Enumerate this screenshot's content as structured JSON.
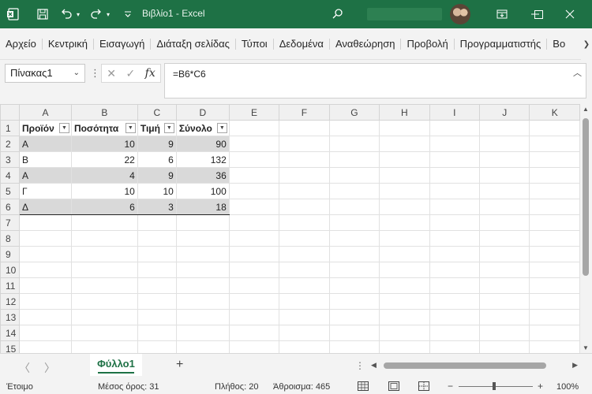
{
  "window": {
    "title": "Βιβλίο1 - Excel"
  },
  "ribbon": {
    "tabs": [
      "Αρχείο",
      "Κεντρική",
      "Εισαγωγή",
      "Διάταξη σελίδας",
      "Τύποι",
      "Δεδομένα",
      "Αναθεώρηση",
      "Προβολή",
      "Προγραμματιστής",
      "Βο"
    ]
  },
  "formula_bar": {
    "name_box": "Πίνακας1",
    "formula": "=B6*C6",
    "fx": "fx"
  },
  "sheet": {
    "columns": [
      "A",
      "B",
      "C",
      "D",
      "E",
      "F",
      "G",
      "H",
      "I",
      "J",
      "K"
    ],
    "rows": [
      "1",
      "2",
      "3",
      "4",
      "5",
      "6",
      "7",
      "8",
      "9",
      "10",
      "11",
      "12",
      "13",
      "14",
      "15"
    ],
    "table_headers": [
      "Προϊόν",
      "Ποσότητα",
      "Τιμή",
      "Σύνολο"
    ],
    "table_rows": [
      [
        "A",
        "10",
        "9",
        "90"
      ],
      [
        "B",
        "22",
        "6",
        "132"
      ],
      [
        "A",
        "4",
        "9",
        "36"
      ],
      [
        "Γ",
        "10",
        "10",
        "100"
      ],
      [
        "Δ",
        "6",
        "3",
        "18"
      ]
    ]
  },
  "sheet_tabs": {
    "active": "Φύλλο1"
  },
  "status": {
    "ready": "Έτοιμο",
    "average": "Μέσος όρος: 31",
    "count": "Πλήθος: 20",
    "sum": "Άθροισμα: 465",
    "zoom": "100%"
  }
}
